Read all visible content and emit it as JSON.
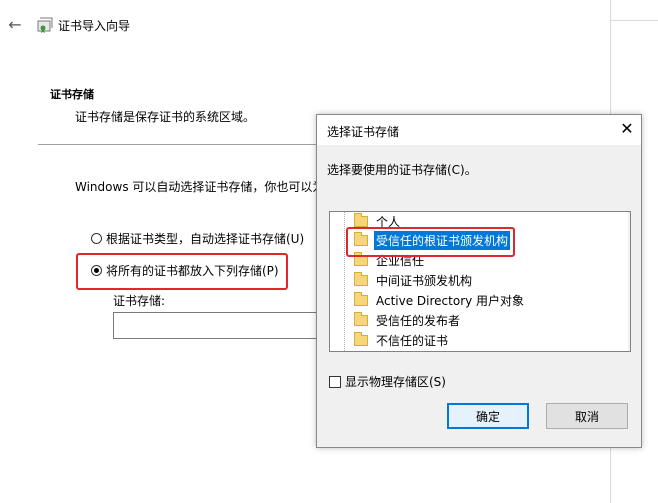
{
  "wizard": {
    "title": "证书导入向导",
    "section_heading": "证书存储",
    "section_desc": "证书存储是保存证书的系统区域。",
    "windows_text": "Windows 可以自动选择证书存储，你也可以为",
    "radio_auto_label": "根据证书类型，自动选择证书存储(U)",
    "radio_manual_label": "将所有的证书都放入下列存储(P)",
    "store_label": "证书存储:",
    "store_value": ""
  },
  "dialog": {
    "title": "选择证书存储",
    "close_glyph": "✕",
    "prompt": "选择要使用的证书存储(C)。",
    "tree_items": [
      {
        "label": "个人",
        "selected": false
      },
      {
        "label": "受信任的根证书颁发机构",
        "selected": true
      },
      {
        "label": "企业信任",
        "selected": false
      },
      {
        "label": "中间证书颁发机构",
        "selected": false
      },
      {
        "label": "Active Directory 用户对象",
        "selected": false
      },
      {
        "label": "受信任的发布者",
        "selected": false
      },
      {
        "label": "不信任的证书",
        "selected": false
      }
    ],
    "show_physical_label": "显示物理存储区(S)",
    "ok_label": "确定",
    "cancel_label": "取消"
  },
  "icons": {
    "back": "back-arrow-icon",
    "wizard": "certificate-icon",
    "folder": "folder-icon"
  },
  "colors": {
    "selection": "#0078d7",
    "highlight_box": "#e3262c",
    "folder": "#f5d77a"
  }
}
